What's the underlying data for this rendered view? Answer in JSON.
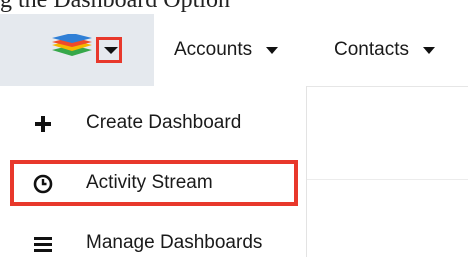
{
  "caption": "g the Dashboard Option",
  "colors": {
    "highlight": "#e8382b",
    "logo_bar_bg": "#e5e9ee",
    "logo_layers": [
      "#2f7fd6",
      "#f04a2a",
      "#f5b800",
      "#36a84a"
    ]
  },
  "navbar": {
    "logo_icon": "stacked-layers-logo",
    "items": [
      {
        "label": "Accounts",
        "icon": "caret-down-icon"
      },
      {
        "label": "Contacts",
        "icon": "caret-down-icon"
      }
    ]
  },
  "dashboard_menu": {
    "items": [
      {
        "label": "Create Dashboard",
        "icon": "plus-icon"
      },
      {
        "label": "Activity Stream",
        "icon": "clock-icon",
        "highlighted": true
      },
      {
        "label": "Manage Dashboards",
        "icon": "list-icon"
      }
    ]
  }
}
